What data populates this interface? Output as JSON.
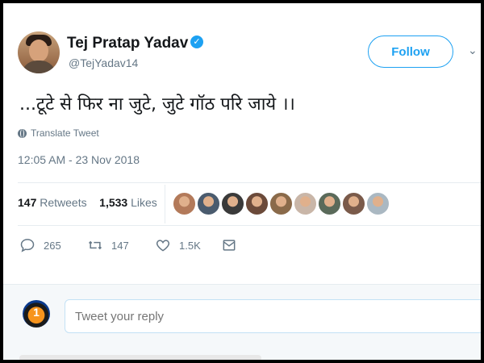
{
  "tweet": {
    "author_name": "Tej Pratap Yadav",
    "handle": "@TejYadav14",
    "follow_label": "Follow",
    "text": "...टूटे से फिर ना जुटे, जुटे गॉठ परि जाये ।।",
    "translate_label": "Translate Tweet",
    "timestamp": "12:05 AM - 23 Nov 2018"
  },
  "stats": {
    "retweets_count": "147",
    "retweets_label": "Retweets",
    "likes_count": "1,533",
    "likes_label": "Likes",
    "liker_avatar_colors": [
      "#b37a5a",
      "#4a5b6e",
      "#3a3a3a",
      "#6b4a3a",
      "#8a6a4a",
      "#c9b6a8",
      "#5a6a5a",
      "#7a5a4a",
      "#aab8c2"
    ]
  },
  "actions": {
    "replies": "265",
    "retweets": "147",
    "likes": "1.5K"
  },
  "reply": {
    "placeholder": "Tweet your reply",
    "avatar_text": "1"
  },
  "colors": {
    "accent": "#1da1f2",
    "text": "#14171a",
    "muted": "#657786"
  }
}
